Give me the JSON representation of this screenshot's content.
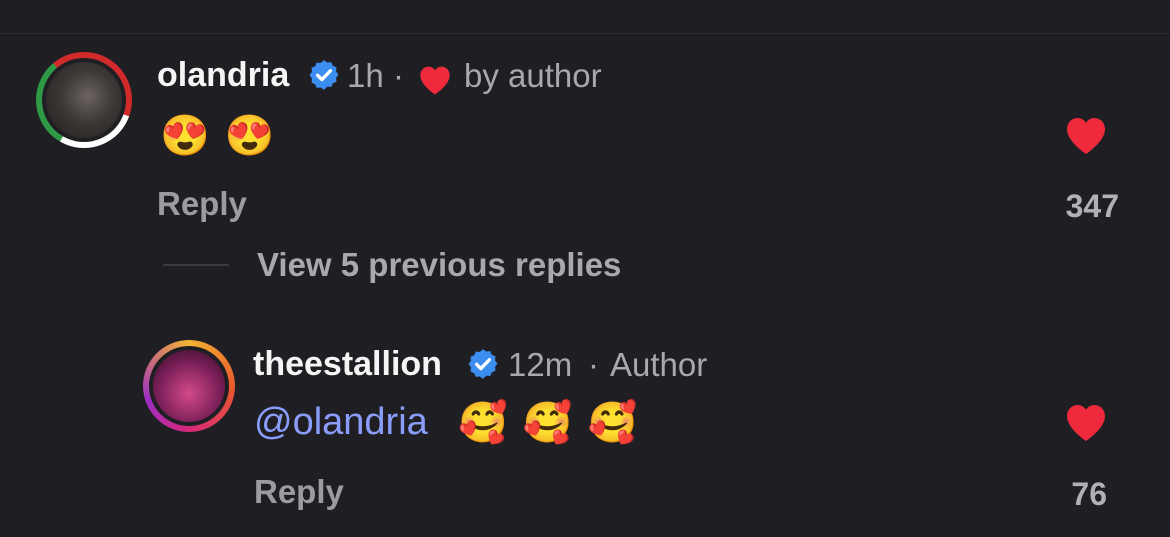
{
  "colors": {
    "background": "#1f1f23",
    "heart": "#ee2a3c",
    "verified": "#3b8df0",
    "mention": "#8b9dfc",
    "secondary_text": "#a8a8ae"
  },
  "comments": [
    {
      "username": "olandria",
      "verified_icon": "verified-badge-icon",
      "time": "1h",
      "separator": "·",
      "liked_by_author_icon": "heart-icon",
      "liked_by_author_text": "by author",
      "text": "😍 😍",
      "reply_label": "Reply",
      "like_count": "347"
    }
  ],
  "view_replies": "View 5 previous replies",
  "replies": [
    {
      "username": "theestallion",
      "verified_icon": "verified-badge-icon",
      "time": "12m",
      "separator": "·",
      "role": "Author",
      "mention": "@olandria",
      "text": "🥰 🥰 🥰",
      "reply_label": "Reply",
      "like_count": "76"
    }
  ]
}
